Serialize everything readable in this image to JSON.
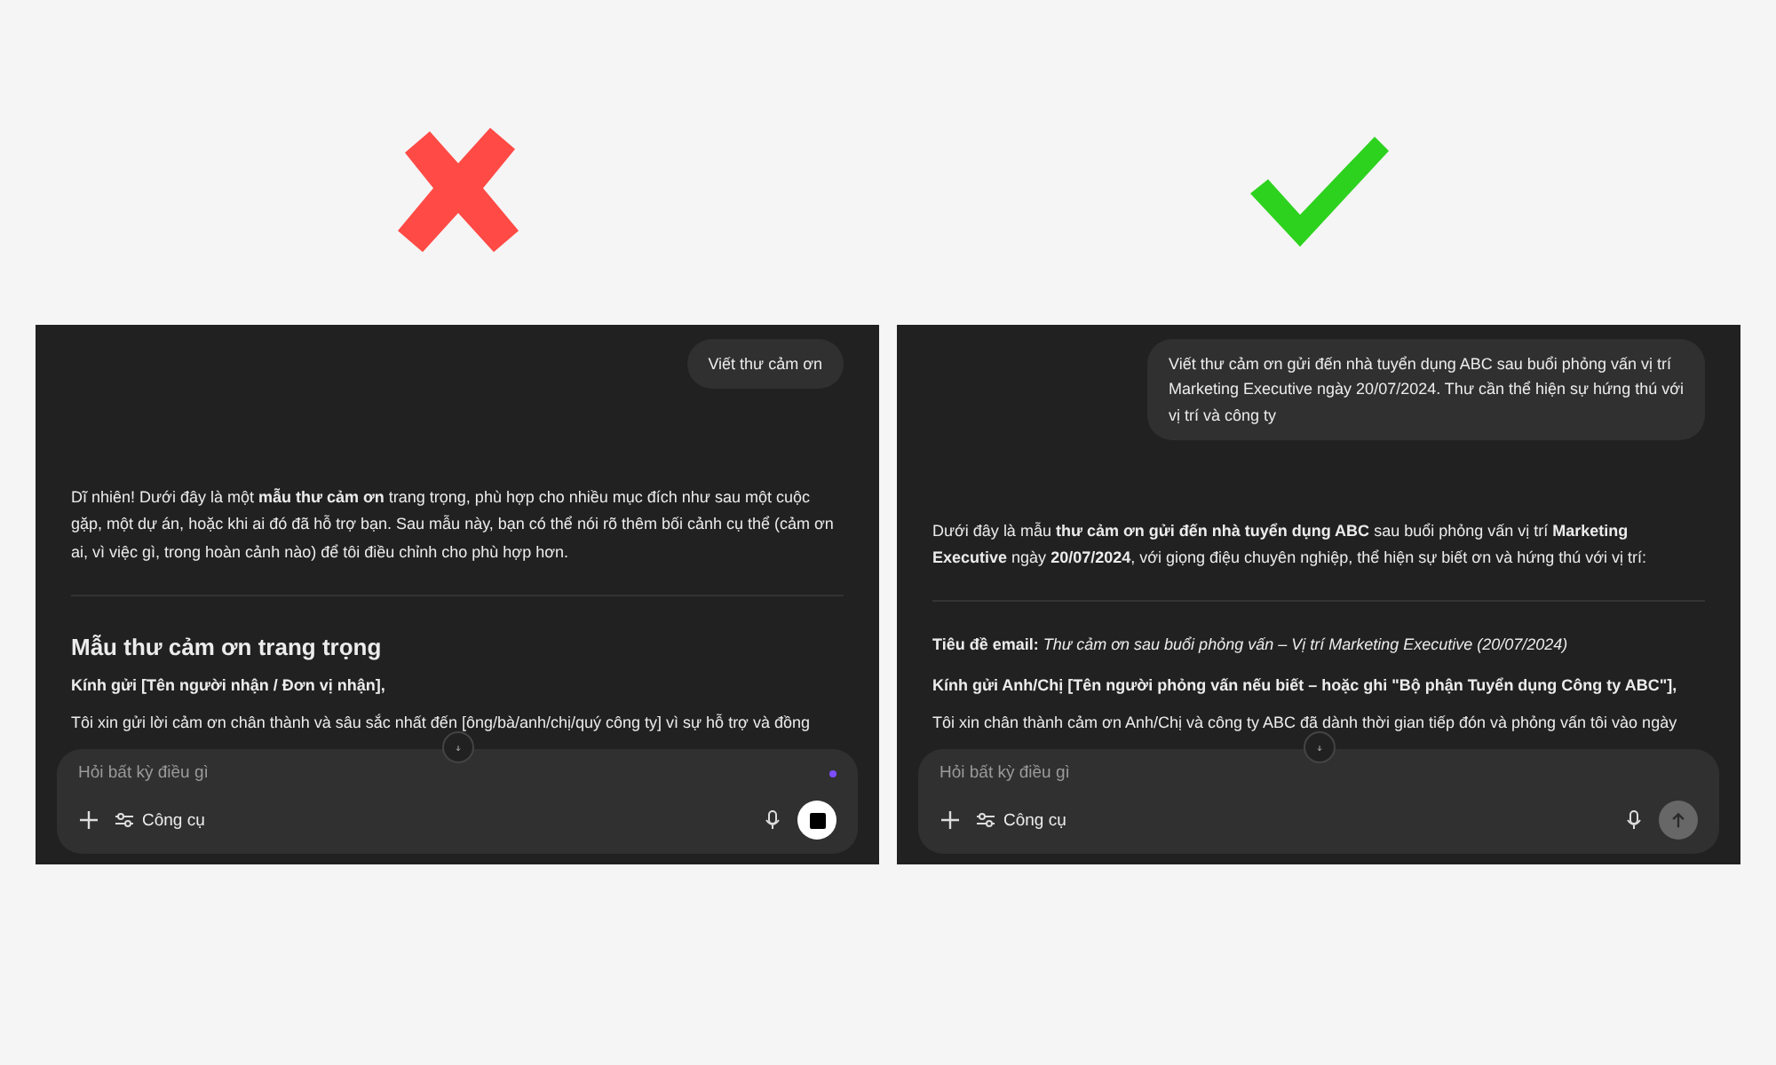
{
  "panels": [
    {
      "kind": "cross",
      "user_message": "Viết thư cảm ơn",
      "blocks": [
        {
          "kind": "paragraph",
          "text": "Dĩ nhiên! Dưới đây là một **mẫu thư cảm ơn** trang trọng, phù hợp cho nhiều mục đích như sau một cuộc gặp, một dự án, hoặc khi ai đó đã hỗ trợ bạn. Sau mẫu này, bạn có thể nói rõ thêm bối cảnh cụ thể (cảm ơn ai, vì việc gì, trong hoàn cảnh nào) để tôi điều chỉnh cho phù hợp hơn."
        },
        {
          "kind": "divider"
        },
        {
          "kind": "heading",
          "text": "Mẫu thư cảm ơn trang trọng"
        },
        {
          "kind": "strong",
          "text": "Kính gửi [Tên người nhận / Đơn vị nhận],"
        },
        {
          "kind": "paragraph",
          "text": "Tôi xin gửi lời cảm ơn chân thành và sâu sắc nhất đến [ông/bà/anh/chị/quý công ty] vì sự hỗ trợ và đồng"
        }
      ],
      "composer": {
        "placeholder": "Hỏi bất kỳ điều gì",
        "tools_label": "Công cụ",
        "generating": true
      }
    },
    {
      "kind": "check",
      "user_message": "Viết thư cảm ơn gửi đến nhà tuyển dụng ABC sau buổi phỏng vấn vị trí Marketing Executive ngày 20/07/2024. Thư cần thể hiện sự hứng thú với vị trí và công ty",
      "blocks": [
        {
          "kind": "paragraph",
          "text": "Dưới đây là mẫu **thư cảm ơn gửi đến nhà tuyển dụng ABC** sau buổi phỏng vấn vị trí **Marketing Executive** ngày **20/07/2024**, với giọng điệu chuyên nghiệp, thể hiện sự biết ơn và hứng thú với vị trí:"
        },
        {
          "kind": "divider"
        },
        {
          "kind": "paragraph",
          "text": "**Tiêu đề email:** *Thư cảm ơn sau buổi phỏng vấn – Vị trí Marketing Executive (20/07/2024)*"
        },
        {
          "kind": "strong",
          "text": "Kính gửi Anh/Chị [Tên người phỏng vấn nếu biết – hoặc ghi \"Bộ phận Tuyển dụng Công ty ABC\"],"
        },
        {
          "kind": "paragraph",
          "text": "Tôi xin chân thành cảm ơn Anh/Chị và công ty ABC đã dành thời gian tiếp đón và phỏng vấn tôi vào ngày"
        }
      ],
      "composer": {
        "placeholder": "Hỏi bất kỳ điều gì",
        "tools_label": "Công cụ",
        "generating": false
      }
    }
  ]
}
